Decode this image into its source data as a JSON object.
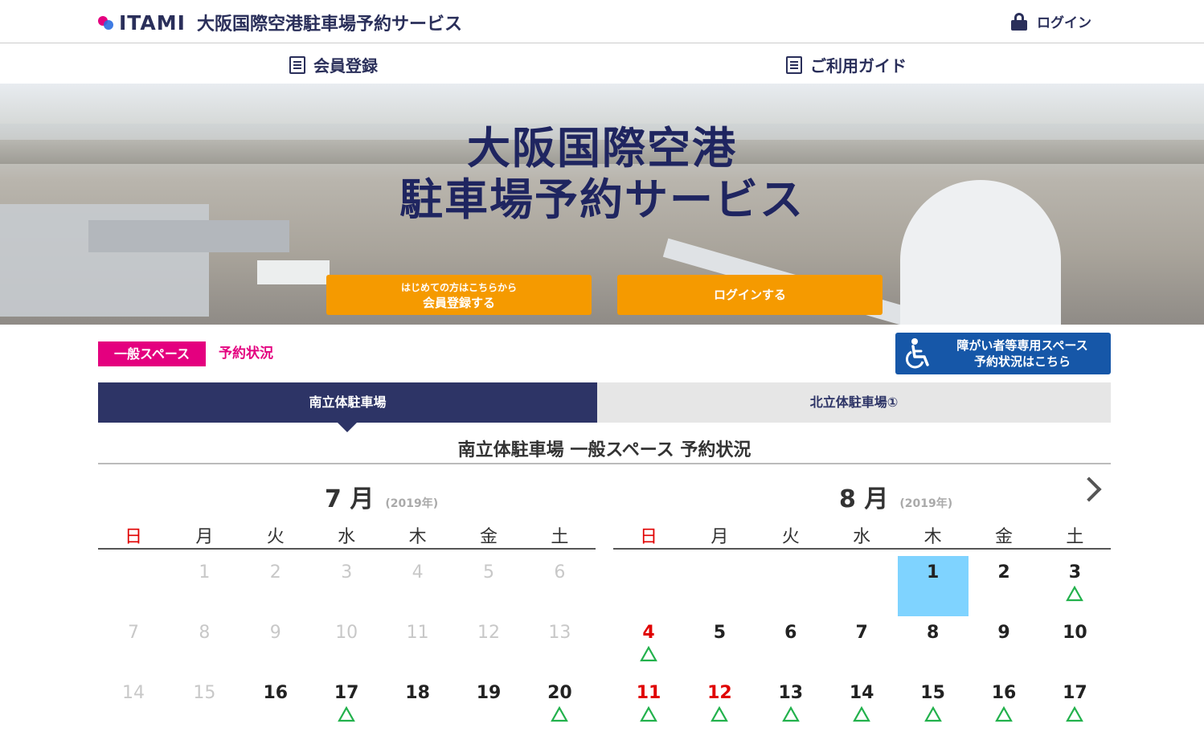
{
  "header": {
    "logo_text": "ITAMI",
    "site_title": "大阪国際空港駐車場予約サービス",
    "login_label": "ログイン"
  },
  "nav": {
    "register_label": "会員登録",
    "guide_label": "ご利用ガイド"
  },
  "hero": {
    "title_line1": "大阪国際空港",
    "title_line2": "駐車場予約サービス",
    "register_btn_small": "はじめての方はこちらから",
    "register_btn_big": "会員登録する",
    "login_btn": "ログインする"
  },
  "space": {
    "general_tag": "一般スペース",
    "status_label": "予約状況",
    "accessible_line1": "障がい者等専用スペース",
    "accessible_line2": "予約状況はこちら"
  },
  "tabs": [
    {
      "label": "南立体駐車場",
      "active": true
    },
    {
      "label": "北立体駐車場①",
      "active": false
    }
  ],
  "section_title": "南立体駐車場 一般スペース 予約状況",
  "weekdays": [
    "日",
    "月",
    "火",
    "水",
    "木",
    "金",
    "土"
  ],
  "months": [
    {
      "label": "7 月",
      "year_label": "(2019年)",
      "rows": [
        [
          {
            "d": ""
          },
          {
            "d": "1",
            "past": true
          },
          {
            "d": "2",
            "past": true
          },
          {
            "d": "3",
            "past": true
          },
          {
            "d": "4",
            "past": true
          },
          {
            "d": "5",
            "past": true
          },
          {
            "d": "6",
            "past": true
          }
        ],
        [
          {
            "d": "7",
            "past": true
          },
          {
            "d": "8",
            "past": true
          },
          {
            "d": "9",
            "past": true
          },
          {
            "d": "10",
            "past": true
          },
          {
            "d": "11",
            "past": true
          },
          {
            "d": "12",
            "past": true
          },
          {
            "d": "13",
            "past": true
          }
        ],
        [
          {
            "d": "14",
            "past": true
          },
          {
            "d": "15",
            "past": true
          },
          {
            "d": "16"
          },
          {
            "d": "17",
            "mark": "△"
          },
          {
            "d": "18"
          },
          {
            "d": "19"
          },
          {
            "d": "20",
            "mark": "△"
          }
        ]
      ]
    },
    {
      "label": "8 月",
      "year_label": "(2019年)",
      "rows": [
        [
          {
            "d": ""
          },
          {
            "d": ""
          },
          {
            "d": ""
          },
          {
            "d": ""
          },
          {
            "d": "1",
            "today": true
          },
          {
            "d": "2"
          },
          {
            "d": "3",
            "mark": "△"
          }
        ],
        [
          {
            "d": "4",
            "red": true,
            "mark": "△"
          },
          {
            "d": "5"
          },
          {
            "d": "6"
          },
          {
            "d": "7"
          },
          {
            "d": "8"
          },
          {
            "d": "9"
          },
          {
            "d": "10"
          }
        ],
        [
          {
            "d": "11",
            "red": true,
            "mark": "△"
          },
          {
            "d": "12",
            "red": true,
            "mark": "△"
          },
          {
            "d": "13",
            "mark": "△"
          },
          {
            "d": "14",
            "mark": "△"
          },
          {
            "d": "15",
            "mark": "△"
          },
          {
            "d": "16",
            "mark": "△"
          },
          {
            "d": "17",
            "mark": "△"
          }
        ]
      ]
    }
  ],
  "colors": {
    "navy": "#2d3466",
    "brand_pink": "#e4007f",
    "orange": "#f59a00",
    "accessible_blue": "#1657a8",
    "today_blue": "#7fd3ff",
    "available_green": "#22b14c",
    "sunday_red": "#e00000"
  },
  "icons": {
    "login": "lock-icon",
    "register": "form-icon",
    "guide": "book-icon",
    "accessible": "wheelchair-icon",
    "next": "chevron-right-icon",
    "availability": "triangle-icon"
  }
}
